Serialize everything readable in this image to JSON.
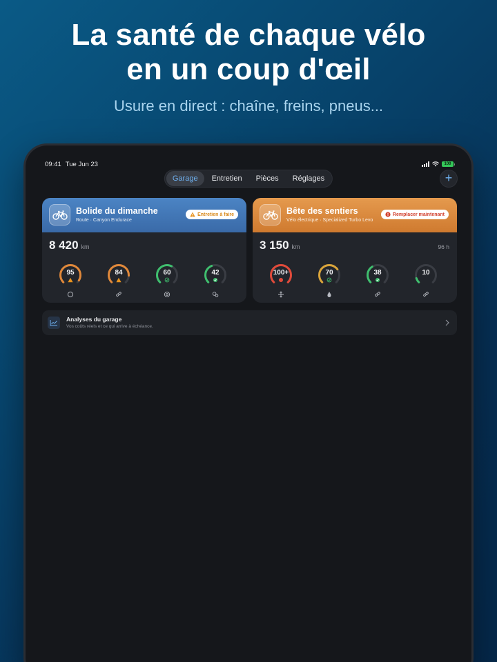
{
  "hero": {
    "title_line1": "La santé de chaque vélo",
    "title_line2": "en un coup d'œil",
    "subtitle": "Usure en direct : chaîne, freins, pneus..."
  },
  "status_bar": {
    "time": "09:41",
    "date": "Tue Jun 23",
    "battery": "100"
  },
  "nav": {
    "tabs": [
      {
        "label": "Garage",
        "active": true
      },
      {
        "label": "Entretien",
        "active": false
      },
      {
        "label": "Pièces",
        "active": false
      },
      {
        "label": "Réglages",
        "active": false
      }
    ],
    "add_icon": "plus-icon"
  },
  "bikes": [
    {
      "name": "Bolide du dimanche",
      "subtitle": "Route · Canyon Endurace",
      "badge": "Entretien à faire",
      "badge_color": "#d98a1c",
      "header_color": "#4479b9",
      "distance": "8 420",
      "distance_unit": "km",
      "hours": "",
      "gauges": [
        {
          "value": "95",
          "level": 0.95,
          "color": "#e0883a",
          "marker": "warning",
          "icon": "tire-icon"
        },
        {
          "value": "84",
          "level": 0.84,
          "color": "#e0883a",
          "marker": "warning",
          "icon": "chain-icon"
        },
        {
          "value": "60",
          "level": 0.6,
          "color": "#3fbf6e",
          "marker": "ok",
          "icon": "brake-disc-icon"
        },
        {
          "value": "42",
          "level": 0.42,
          "color": "#3fbf6e",
          "marker": "ok",
          "icon": "gears-icon"
        }
      ]
    },
    {
      "name": "Bête des sentiers",
      "subtitle": "Vélo électrique · Specialized Turbo Levo",
      "badge": "Remplacer maintenant",
      "badge_color": "#d2412f",
      "header_color": "#db8a3f",
      "distance": "3 150",
      "distance_unit": "km",
      "hours": "96 h",
      "gauges": [
        {
          "value": "100+",
          "level": 1.0,
          "color": "#e04a3a",
          "marker": "critical",
          "icon": "suspension-icon"
        },
        {
          "value": "70",
          "level": 0.7,
          "color": "#d9a43a",
          "marker": "ok",
          "icon": "fluid-drop-icon"
        },
        {
          "value": "38",
          "level": 0.38,
          "color": "#3fbf6e",
          "marker": "ok",
          "icon": "chain-icon"
        },
        {
          "value": "10",
          "level": 0.1,
          "color": "#3fbf6e",
          "marker": "none",
          "icon": "chain-icon"
        }
      ]
    }
  ],
  "analytics": {
    "title": "Analyses du garage",
    "subtitle": "Vos coûts réels et ce qui arrive à échéance.",
    "icon": "chart-line-icon"
  }
}
